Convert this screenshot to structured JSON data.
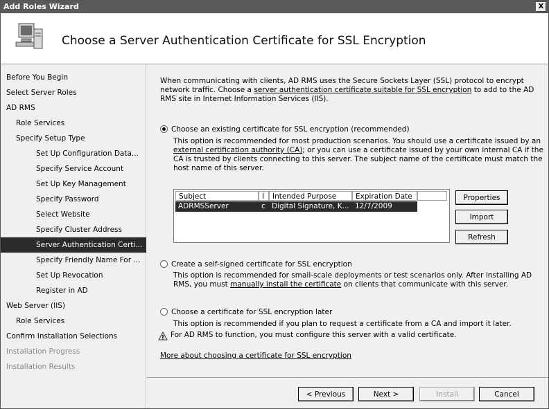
{
  "window": {
    "title": "Add Roles Wizard",
    "close": "X"
  },
  "header": {
    "title": "Choose a Server Authentication Certificate for SSL Encryption",
    "icon": "server-computer-icon"
  },
  "sidebar": {
    "items": [
      {
        "label": "Before You Begin",
        "level": 0,
        "state": "normal"
      },
      {
        "label": "Select Server Roles",
        "level": 0,
        "state": "normal"
      },
      {
        "label": "AD RMS",
        "level": 0,
        "state": "normal"
      },
      {
        "label": "Role Services",
        "level": 1,
        "state": "normal"
      },
      {
        "label": "Specify Setup Type",
        "level": 1,
        "state": "normal"
      },
      {
        "label": "Set Up Configuration Data...",
        "level": 2,
        "state": "normal"
      },
      {
        "label": "Specify Service Account",
        "level": 2,
        "state": "normal"
      },
      {
        "label": "Set Up Key Management",
        "level": 2,
        "state": "normal"
      },
      {
        "label": "Specify Password",
        "level": 2,
        "state": "normal"
      },
      {
        "label": "Select Website",
        "level": 2,
        "state": "normal"
      },
      {
        "label": "Specify Cluster Address",
        "level": 2,
        "state": "normal"
      },
      {
        "label": "Server Authentication Certi...",
        "level": 2,
        "state": "active"
      },
      {
        "label": "Specify Friendly Name For ...",
        "level": 2,
        "state": "normal"
      },
      {
        "label": "Set Up Revocation",
        "level": 2,
        "state": "normal"
      },
      {
        "label": "Register in AD",
        "level": 2,
        "state": "normal"
      },
      {
        "label": "Web Server (IIS)",
        "level": 0,
        "state": "normal"
      },
      {
        "label": "Role Services",
        "level": 1,
        "state": "normal"
      },
      {
        "label": "Confirm Installation Selections",
        "level": 0,
        "state": "normal"
      },
      {
        "label": "Installation Progress",
        "level": 0,
        "state": "disabled"
      },
      {
        "label": "Installation Results",
        "level": 0,
        "state": "disabled"
      }
    ]
  },
  "main": {
    "intro": {
      "part1": "When communicating with clients, AD RMS uses the Secure Sockets Layer (SSL) protocol to encrypt network traffic. Choose a ",
      "link": "server authentication certificate suitable for SSL encryption",
      "part2": " to add to the AD RMS site in Internet Information Services (IIS)."
    },
    "option1": {
      "label": "Choose an existing certificate for SSL encryption (recommended)",
      "selected": true,
      "desc_part1": "This option is recommended for most production scenarios. You should use a certificate issued by an ",
      "desc_link": "external certification authority (CA)",
      "desc_part2": "; or you can use a certificate issued by your own internal CA if the CA is trusted by clients connecting to this server. The subject name of the certificate must match the host name of this server."
    },
    "cert_table": {
      "columns": [
        "Subject",
        "I",
        "Intended Purpose",
        "Expiration Date"
      ],
      "rows": [
        {
          "subject": "ADRMSServer",
          "issued": "c",
          "purpose": "Digital Signature, K...",
          "expires": "12/7/2009"
        }
      ]
    },
    "buttons": {
      "properties": "Properties",
      "import": "Import",
      "refresh": "Refresh"
    },
    "option2": {
      "label": "Create a self-signed certificate for SSL encryption",
      "selected": false,
      "desc_part1": "This option is recommended for small-scale deployments or test scenarios only. After installing AD RMS, you must ",
      "desc_link": "manually install the certificate",
      "desc_part2": " on clients that communicate with this server."
    },
    "option3": {
      "label": "Choose a certificate for SSL encryption later",
      "selected": false,
      "desc": "This option is recommended if you plan to request a certificate from a CA and import it later.",
      "warning": "For AD RMS to function, you must configure this server with a valid certificate.",
      "warning_icon": "warning-triangle-icon"
    },
    "more_link": "More about choosing a certificate for SSL encryption"
  },
  "footer": {
    "previous": "< Previous",
    "next": "Next >",
    "install": "Install",
    "cancel": "Cancel"
  }
}
